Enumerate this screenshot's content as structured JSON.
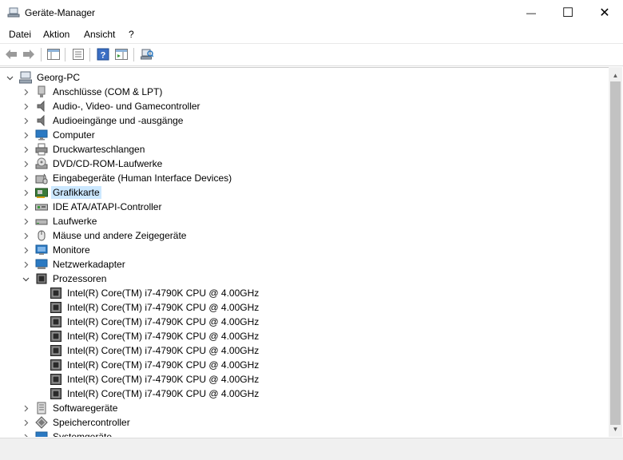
{
  "window": {
    "title": "Geräte-Manager",
    "minimize_symbol": "—",
    "maximize_symbol": "☐",
    "close_symbol": "✕"
  },
  "menu": [
    "Datei",
    "Aktion",
    "Ansicht",
    "?"
  ],
  "toolbar": {
    "icons": [
      "back-arrow-icon",
      "forward-arrow-icon",
      "show-hide-console-tree-icon",
      "properties-icon",
      "help-icon",
      "action-pane-icon",
      "scan-hardware-icon"
    ]
  },
  "tree": {
    "root": "Georg-PC",
    "categories": [
      {
        "label": "Anschlüsse (COM & LPT)",
        "icon": "port-icon",
        "expanded": false
      },
      {
        "label": "Audio-, Video- und Gamecontroller",
        "icon": "speaker-icon",
        "expanded": false
      },
      {
        "label": "Audioeingänge und -ausgänge",
        "icon": "speaker-icon",
        "expanded": false
      },
      {
        "label": "Computer",
        "icon": "computer-icon",
        "expanded": false
      },
      {
        "label": "Druckwarteschlangen",
        "icon": "printer-icon",
        "expanded": false
      },
      {
        "label": "DVD/CD-ROM-Laufwerke",
        "icon": "dvd-drive-icon",
        "expanded": false
      },
      {
        "label": "Eingabegeräte (Human Interface Devices)",
        "icon": "hid-icon",
        "expanded": false
      },
      {
        "label": "Grafikkarte",
        "icon": "display-adapter-icon",
        "expanded": false,
        "selected": true
      },
      {
        "label": "IDE ATA/ATAPI-Controller",
        "icon": "ide-controller-icon",
        "expanded": false
      },
      {
        "label": "Laufwerke",
        "icon": "disk-drive-icon",
        "expanded": false
      },
      {
        "label": "Mäuse und andere Zeigegeräte",
        "icon": "mouse-icon",
        "expanded": false
      },
      {
        "label": "Monitore",
        "icon": "monitor-icon",
        "expanded": false
      },
      {
        "label": "Netzwerkadapter",
        "icon": "network-adapter-icon",
        "expanded": false
      },
      {
        "label": "Prozessoren",
        "icon": "processor-icon",
        "expanded": true,
        "children": [
          "Intel(R) Core(TM) i7-4790K CPU @ 4.00GHz",
          "Intel(R) Core(TM) i7-4790K CPU @ 4.00GHz",
          "Intel(R) Core(TM) i7-4790K CPU @ 4.00GHz",
          "Intel(R) Core(TM) i7-4790K CPU @ 4.00GHz",
          "Intel(R) Core(TM) i7-4790K CPU @ 4.00GHz",
          "Intel(R) Core(TM) i7-4790K CPU @ 4.00GHz",
          "Intel(R) Core(TM) i7-4790K CPU @ 4.00GHz",
          "Intel(R) Core(TM) i7-4790K CPU @ 4.00GHz"
        ]
      },
      {
        "label": "Softwaregeräte",
        "icon": "software-device-icon",
        "expanded": false
      },
      {
        "label": "Speichercontroller",
        "icon": "storage-controller-icon",
        "expanded": false
      },
      {
        "label": "Systemgeräte",
        "icon": "system-devices-icon",
        "expanded": false
      }
    ]
  },
  "colors": {
    "selection": "#cce8ff",
    "icon_blue": "#2b79c2"
  }
}
